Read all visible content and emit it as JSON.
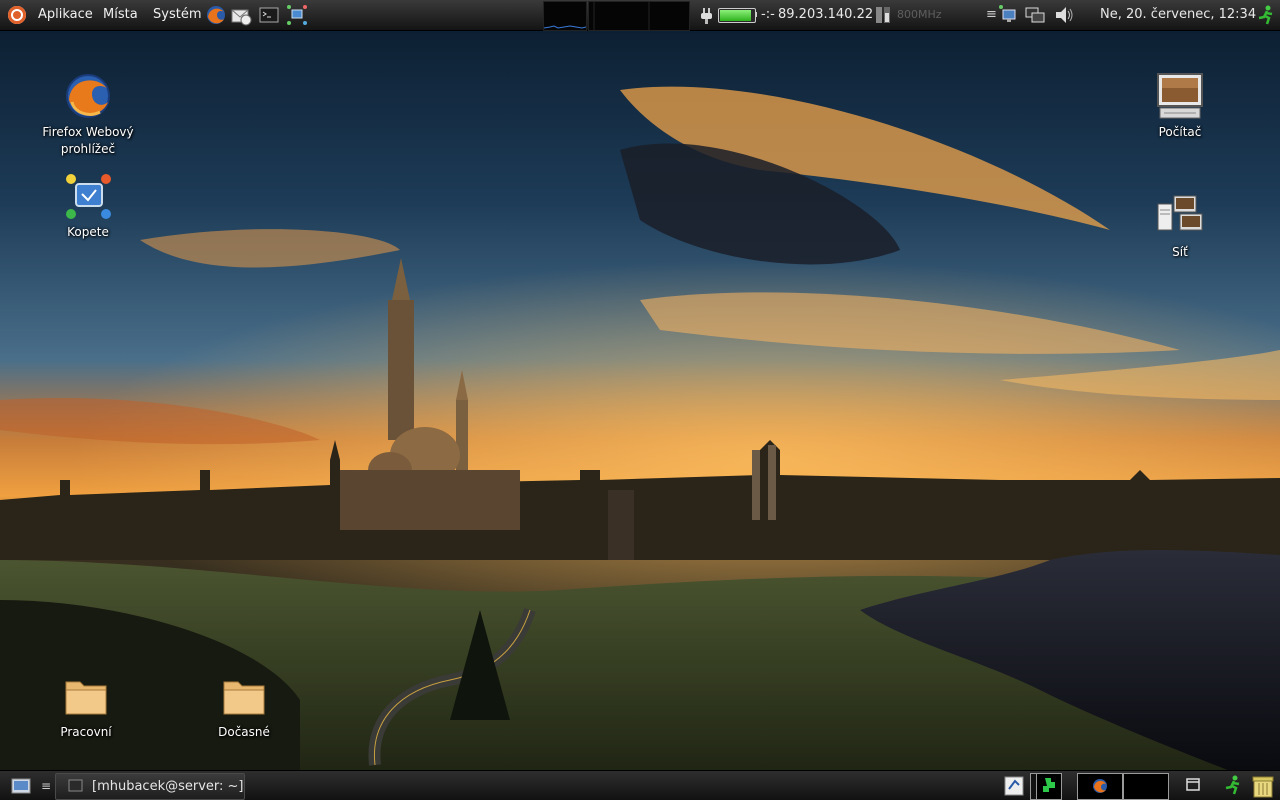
{
  "top_panel": {
    "menus": [
      "Aplikace",
      "Místa",
      "Systém"
    ],
    "ip_prefix": "-:-",
    "ip_address": "89.203.140.22",
    "cpu_freq": "800MHz",
    "clock": "Ne, 20. červenec, 12:34",
    "battery_level": 0.92,
    "battery_color": "#3ccf2a",
    "icons": {
      "logo": "ubuntu-logo-icon",
      "firefox": "firefox-icon",
      "mail": "mail-icon",
      "terminal": "terminal-icon",
      "network_launcher": "network-icon",
      "power": "power-plug-icon",
      "network_status": "network-status-icon",
      "display": "display-icon",
      "volume": "volume-icon",
      "logout": "run-exit-icon"
    }
  },
  "desktop": {
    "icons": [
      {
        "label": "Firefox Webový prohlížeč",
        "icon": "firefox-icon"
      },
      {
        "label": "Kopete",
        "icon": "kopete-icon"
      },
      {
        "label": "Počítač",
        "icon": "computer-icon"
      },
      {
        "label": "Síť",
        "icon": "network-icon"
      },
      {
        "label": "Pracovní",
        "icon": "folder-icon"
      },
      {
        "label": "Dočasné",
        "icon": "folder-icon"
      }
    ]
  },
  "bottom_panel": {
    "task_title": "[mhubacek@server: ~]",
    "icons": {
      "show_desktop": "show-desktop-icon",
      "task_window": "terminal-window-icon",
      "update": "update-notifier-icon",
      "workspace": "workspace-switcher-icon",
      "firefox": "firefox-icon",
      "window": "window-icon",
      "run": "run-icon",
      "trash": "trash-icon"
    }
  }
}
